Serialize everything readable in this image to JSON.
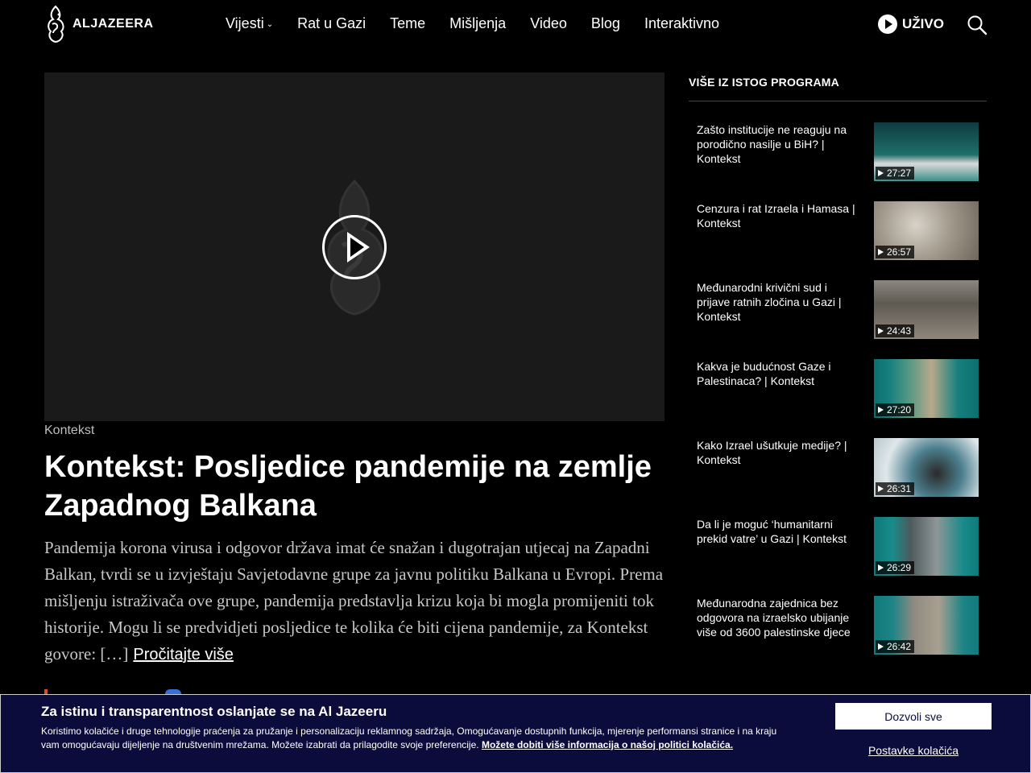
{
  "header": {
    "brand": "ALJAZEERA",
    "nav": [
      {
        "label": "Vijesti",
        "has_dropdown": true
      },
      {
        "label": "Rat u Gazi"
      },
      {
        "label": "Teme"
      },
      {
        "label": "Mišljenja"
      },
      {
        "label": "Video"
      },
      {
        "label": "Blog"
      },
      {
        "label": "Interaktivno"
      }
    ],
    "live_label": "UŽIVO"
  },
  "article": {
    "category": "Kontekst",
    "title": "Kontekst: Posljedice pandemije na zemlje Zapadnog Balkana",
    "description": "Pandemija korona virusa i odgovor država imat će snažan i dugotrajan utjecaj na Zapadni Balkan, tvrdi se u izvještaju Savjetodavne grupe za javnu politiku Balkana u Evropi. Prema mišljenju istraživača ove grupe, pandemija predstavlja krizu koja bi mogla promijeniti tok historije. Mogu li se predvidjeti posljedice te kolika će biti cijena pandemije, za Kontekst govore: […]",
    "read_more": "Pročitajte više"
  },
  "sidebar": {
    "heading": "VIŠE IZ ISTOG PROGRAMA",
    "items": [
      {
        "title": "Zašto institucije ne reaguju na porodično nasilje u BiH? | Kontekst",
        "duration": "27:27",
        "thumb_color": "#1f6f6a"
      },
      {
        "title": "Cenzura i rat Izraela i Hamasa | Kontekst",
        "duration": "26:57",
        "thumb_color": "#8e8477"
      },
      {
        "title": "Međunarodni krivični sud i prijave ratnih zločina u Gazi | Kontekst",
        "duration": "24:43",
        "thumb_color": "#6e6a62"
      },
      {
        "title": "Kakva je budućnost Gaze i Palestinaca? | Kontekst",
        "duration": "27:20",
        "thumb_color": "#17807f"
      },
      {
        "title": "Kako Izrael ušutkuje medije? | Kontekst",
        "duration": "26:31",
        "thumb_color": "#4c7f8e"
      },
      {
        "title": "Da li je moguć ‘humanitarni prekid vatre’ u Gazi | Kontekst",
        "duration": "26:29",
        "thumb_color": "#1a8a8a"
      },
      {
        "title": "Međunarodna zajednica bez odgovora na izraelsko ubijanje više od 3600 palestinske djece",
        "duration": "26:42",
        "thumb_color": "#1e8486"
      }
    ]
  },
  "cookie": {
    "title": "Za istinu i transparentnost oslanjate se na Al Jazeeru",
    "text": "Koristimo kolačiće i druge tehnologije praćenja za pružanje i personalizaciju reklamnog sadržaja, Omogućavanje dostupnih funkcija, mjerenje performansi stranice i na kraju vam omogućavaju dijeljenje na društvenim mrežama. Možete izabrati da prilagodite svoje preferencije.",
    "link": "Možete dobiti više informacija o našoj politici kolačića.",
    "allow_all": "Dozvoli sve",
    "settings": "Postavke kolačića"
  }
}
